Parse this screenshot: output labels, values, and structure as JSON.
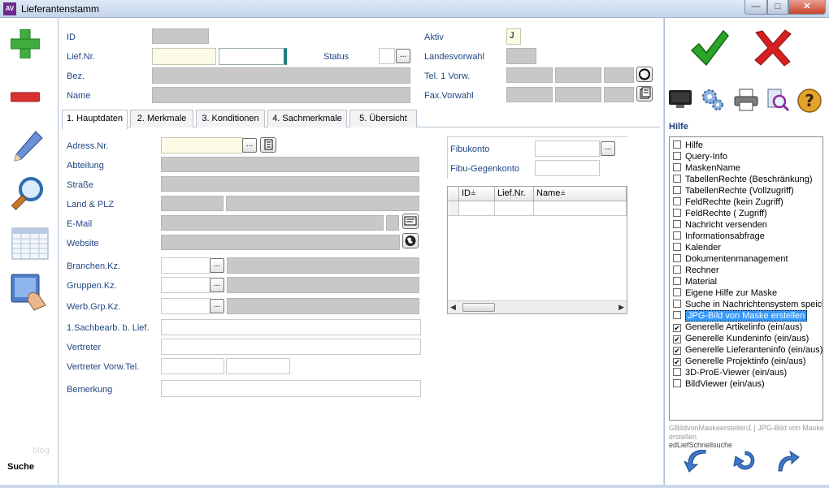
{
  "window": {
    "title": "Lieferantenstamm",
    "app_icon": "AV"
  },
  "left_toolbar": {
    "search_label": "Suche",
    "faint_text": "blog"
  },
  "header_fields": {
    "id_label": "ID",
    "lief_nr_label": "Lief.Nr.",
    "bez_label": "Bez.",
    "name_label": "Name",
    "status_label": "Status",
    "aktiv_label": "Aktiv",
    "aktiv_value": "J",
    "landesvorwahl_label": "Landesvorwahl",
    "tel1_label": "Tel. 1 Vorw.",
    "fax_label": "Fax.Vorwahl"
  },
  "tabs": [
    {
      "label": "1. Hauptdaten"
    },
    {
      "label": "2. Merkmale"
    },
    {
      "label": "3. Konditionen"
    },
    {
      "label": "4. Sachmerkmale"
    },
    {
      "label": "5. Übersicht"
    }
  ],
  "form": {
    "adress_nr": "Adress.Nr.",
    "abteilung": "Abteilung",
    "strasse": "Straße",
    "land_plz": "Land & PLZ",
    "email": "E-Mail",
    "website": "Website",
    "branchen": "Branchen.Kz.",
    "gruppen": "Gruppen.Kz.",
    "werb": "Werb.Grp.Kz.",
    "sachbearb": "1.Sachbearb. b. Lief.",
    "vertreter": "Vertreter",
    "vertreter_tel": "Vertreter Vorw.Tel.",
    "bemerkung": "Bemerkung"
  },
  "fibu": {
    "fibukonto": "Fibukonto",
    "gegenkonto": "Fibu-Gegenkonto"
  },
  "grid": {
    "columns": [
      "ID",
      "Lief.Nr.",
      "Name"
    ]
  },
  "help": {
    "title": "Hilfe",
    "items": [
      {
        "label": "Hilfe",
        "checked": false
      },
      {
        "label": "Query-Info",
        "checked": false
      },
      {
        "label": "MaskenName",
        "checked": false
      },
      {
        "label": "TabellenRechte (Beschränkung)",
        "checked": false
      },
      {
        "label": "TabellenRechte (Vollzugriff)",
        "checked": false
      },
      {
        "label": "FeldRechte (kein Zugriff)",
        "checked": false
      },
      {
        "label": "FeldRechte ( Zugriff)",
        "checked": false
      },
      {
        "label": "Nachricht versenden",
        "checked": false
      },
      {
        "label": "Informationsabfrage",
        "checked": false
      },
      {
        "label": "Kalender",
        "checked": false
      },
      {
        "label": "Dokumentenmanagement",
        "checked": false
      },
      {
        "label": "Rechner",
        "checked": false
      },
      {
        "label": "Material",
        "checked": false
      },
      {
        "label": "Eigene Hilfe zur Maske",
        "checked": false
      },
      {
        "label": "Suche in Nachrichtensystem speicl",
        "checked": false
      },
      {
        "label": "JPG-Bild von Maske erstellen",
        "checked": false,
        "selected": true
      },
      {
        "label": "Generelle Artikelinfo (ein/aus)",
        "checked": true
      },
      {
        "label": "Generelle Kundeninfo (ein/aus)",
        "checked": true
      },
      {
        "label": "Generelle Lieferanteninfo (ein/aus)",
        "checked": true
      },
      {
        "label": "Generelle Projektinfo (ein/aus)",
        "checked": true
      },
      {
        "label": "3D-ProE-Viewer (ein/aus)",
        "checked": false
      },
      {
        "label": "BildViewer (ein/aus)",
        "checked": false
      }
    ],
    "status_line1": "GBildvonMaskeerstellen1 | JPG-Bild von Maske erstellen",
    "status_line2": "edLiefSchnellsuche"
  },
  "colors": {
    "label_blue": "#1f4682",
    "ok_green": "#2aa52a",
    "cancel_red": "#d42020",
    "selection": "#3399ff"
  }
}
